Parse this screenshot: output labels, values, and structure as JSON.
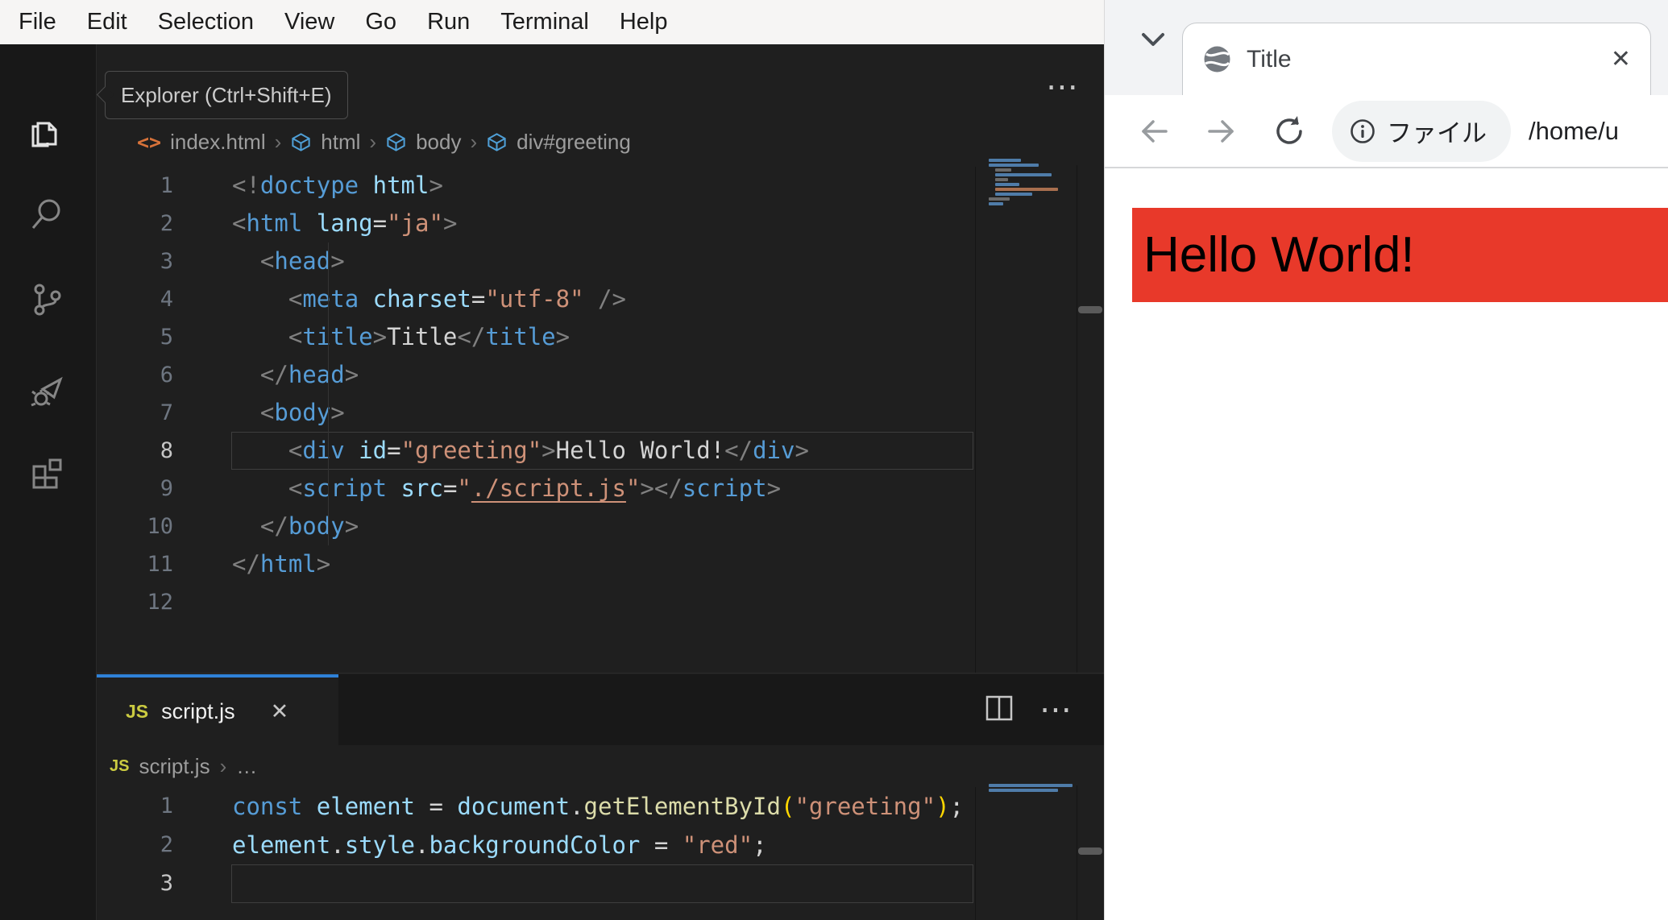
{
  "vscode": {
    "menu": [
      "File",
      "Edit",
      "Selection",
      "View",
      "Go",
      "Run",
      "Terminal",
      "Help"
    ],
    "tooltip": "Explorer (Ctrl+Shift+E)",
    "activity_icons": [
      "explorer-files-icon",
      "search-icon",
      "source-control-icon",
      "run-debug-icon",
      "extensions-icon"
    ],
    "editor_actions_label": "⋯",
    "editor_html": {
      "breadcrumb": [
        "index.html",
        "html",
        "body",
        "div#greeting"
      ],
      "active_line": 8,
      "lines": [
        [
          [
            "p",
            "<!"
          ],
          [
            "t",
            "doctype"
          ],
          [
            "x",
            " "
          ],
          [
            "a",
            "html"
          ],
          [
            "p",
            ">"
          ]
        ],
        [
          [
            "p",
            "<"
          ],
          [
            "t",
            "html"
          ],
          [
            "x",
            " "
          ],
          [
            "a",
            "lang"
          ],
          [
            "o",
            "="
          ],
          [
            "s",
            "\"ja\""
          ],
          [
            "p",
            ">"
          ]
        ],
        [
          [
            "x",
            "  "
          ],
          [
            "p",
            "<"
          ],
          [
            "t",
            "head"
          ],
          [
            "p",
            ">"
          ]
        ],
        [
          [
            "x",
            "    "
          ],
          [
            "p",
            "<"
          ],
          [
            "t",
            "meta"
          ],
          [
            "x",
            " "
          ],
          [
            "a",
            "charset"
          ],
          [
            "o",
            "="
          ],
          [
            "s",
            "\"utf-8\""
          ],
          [
            "p",
            " />"
          ]
        ],
        [
          [
            "x",
            "    "
          ],
          [
            "p",
            "<"
          ],
          [
            "t",
            "title"
          ],
          [
            "p",
            ">"
          ],
          [
            "x",
            "Title"
          ],
          [
            "p",
            "</"
          ],
          [
            "t",
            "title"
          ],
          [
            "p",
            ">"
          ]
        ],
        [
          [
            "x",
            "  "
          ],
          [
            "p",
            "</"
          ],
          [
            "t",
            "head"
          ],
          [
            "p",
            ">"
          ]
        ],
        [
          [
            "x",
            "  "
          ],
          [
            "p",
            "<"
          ],
          [
            "t",
            "body"
          ],
          [
            "p",
            ">"
          ]
        ],
        [
          [
            "x",
            "    "
          ],
          [
            "p",
            "<"
          ],
          [
            "t",
            "div"
          ],
          [
            "x",
            " "
          ],
          [
            "a",
            "id"
          ],
          [
            "o",
            "="
          ],
          [
            "s",
            "\"greeting\""
          ],
          [
            "p",
            ">"
          ],
          [
            "x",
            "Hello World!"
          ],
          [
            "p",
            "</"
          ],
          [
            "t",
            "div"
          ],
          [
            "p",
            ">"
          ]
        ],
        [
          [
            "x",
            "    "
          ],
          [
            "p",
            "<"
          ],
          [
            "t",
            "script"
          ],
          [
            "x",
            " "
          ],
          [
            "a",
            "src"
          ],
          [
            "o",
            "="
          ],
          [
            "s",
            "\""
          ],
          [
            "l",
            "./script.js"
          ],
          [
            "s",
            "\""
          ],
          [
            "p",
            ">"
          ],
          [
            "p",
            "</"
          ],
          [
            "t",
            "script"
          ],
          [
            "p",
            ">"
          ]
        ],
        [
          [
            "x",
            "  "
          ],
          [
            "p",
            "</"
          ],
          [
            "t",
            "body"
          ],
          [
            "p",
            ">"
          ]
        ],
        [
          [
            "p",
            "</"
          ],
          [
            "t",
            "html"
          ],
          [
            "p",
            ">"
          ]
        ],
        []
      ]
    },
    "panel_js": {
      "tab_label": "script.js",
      "tab_close_label": "✕",
      "panel_actions_label": "⋯",
      "breadcrumb_file": "script.js",
      "breadcrumb_more": "…",
      "js_badge": "JS",
      "active_line": 3,
      "lines": [
        [
          [
            "k",
            "const"
          ],
          [
            "x",
            " "
          ],
          [
            "v",
            "element"
          ],
          [
            "o",
            " = "
          ],
          [
            "v",
            "document"
          ],
          [
            "o",
            "."
          ],
          [
            "f",
            "getElementById"
          ],
          [
            "b",
            "("
          ],
          [
            "s",
            "\"greeting\""
          ],
          [
            "b",
            ")"
          ],
          [
            "o",
            ";"
          ]
        ],
        [
          [
            "v",
            "element"
          ],
          [
            "o",
            "."
          ],
          [
            "v",
            "style"
          ],
          [
            "o",
            "."
          ],
          [
            "v",
            "backgroundColor"
          ],
          [
            "o",
            " = "
          ],
          [
            "s",
            "\"red\""
          ],
          [
            "o",
            ";"
          ]
        ],
        []
      ]
    }
  },
  "browser": {
    "tab_title": "Title",
    "tab_close_label": "✕",
    "chip_label": "ファイル",
    "url": "/home/u",
    "page_text": "Hello World!",
    "colors": {
      "banner_red": "#e8392a",
      "accent_blue": "#2f81d7"
    }
  }
}
